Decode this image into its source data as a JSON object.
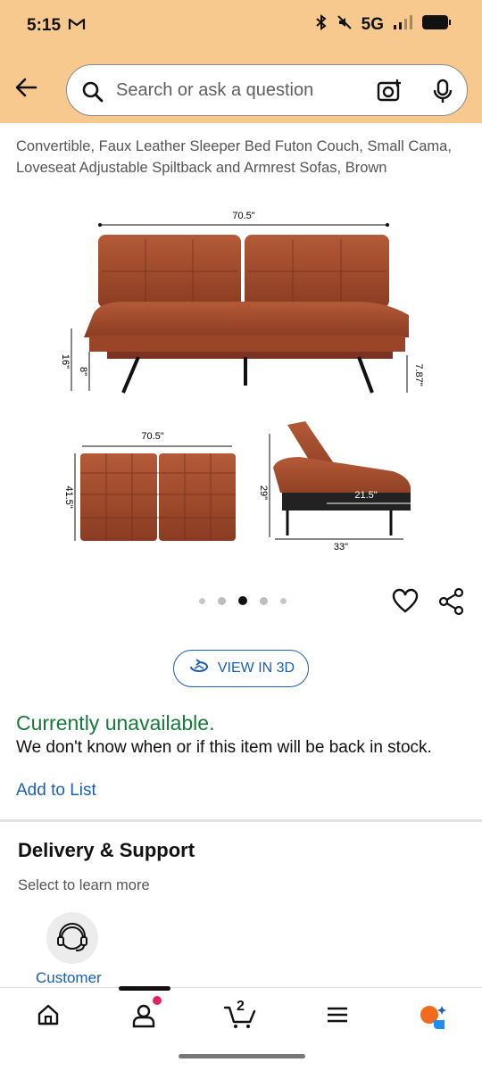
{
  "status_bar": {
    "time": "5:15",
    "network": "5G"
  },
  "search": {
    "placeholder": "Search or ask a question"
  },
  "product": {
    "title": "Convertible, Faux Leather Sleeper Bed Futon Couch, Small Cama, Loveseat Adjustable Spiltback and Armrest Sofas, Brown",
    "dimensions": {
      "width_top": "70.5\"",
      "height_seat": "16\"",
      "leg_height": "8\"",
      "clearance": "7.87\"",
      "bed_width": "70.5\"",
      "bed_length": "41.5\"",
      "side_height": "29\"",
      "side_depth": "33\"",
      "seat_depth": "21.5\""
    },
    "carousel": {
      "total": 5,
      "active_index": 2
    }
  },
  "actions": {
    "view_3d": "VIEW IN 3D"
  },
  "availability": {
    "status": "Currently unavailable.",
    "note": "We don't know when or if this item will be back in stock.",
    "add_to_list": "Add to List"
  },
  "delivery": {
    "title": "Delivery & Support",
    "subtitle": "Select to learn more",
    "customer_label": "Customer"
  },
  "bottom_nav": {
    "cart_count": "2"
  },
  "colors": {
    "header": "#f7c98f",
    "link": "#1a5fb4",
    "available_green": "#157a3a"
  },
  "icons": [
    "back-arrow-icon",
    "search-icon",
    "camera-icon",
    "mic-icon",
    "heart-icon",
    "share-icon",
    "3d-rotate-icon",
    "headset-icon",
    "home-icon",
    "profile-icon",
    "cart-icon",
    "menu-icon",
    "ai-assistant-icon"
  ]
}
